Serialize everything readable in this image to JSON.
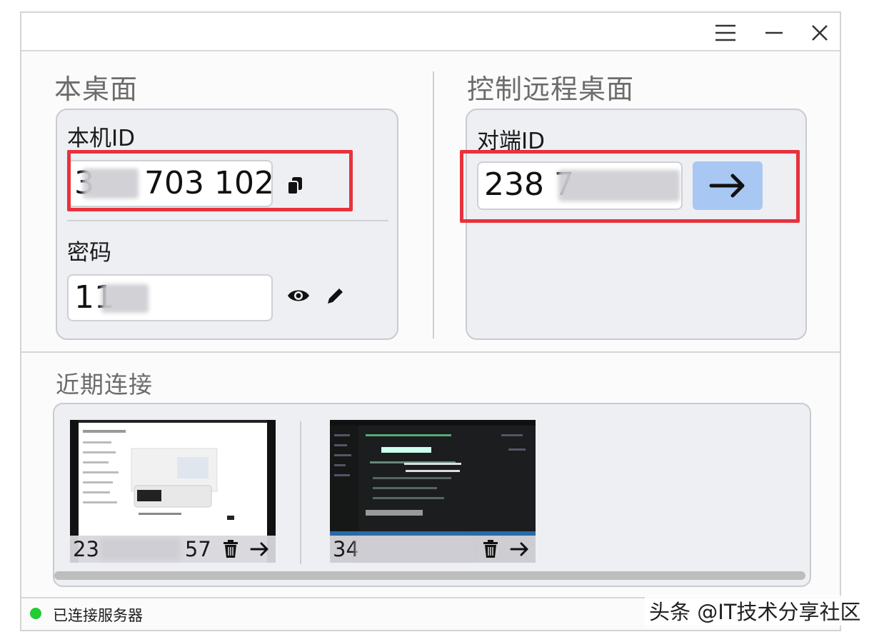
{
  "window": {
    "buttons": {
      "menu": "menu-icon",
      "minimize": "minimize-icon",
      "close": "close-icon"
    }
  },
  "local_desktop": {
    "title": "本桌面",
    "id_label": "本机ID",
    "id_value_prefix": "3",
    "id_value_suffix": "703 102",
    "password_label": "密码",
    "password_value": "11"
  },
  "remote_control": {
    "title": "控制远程桌面",
    "peer_id_label": "对端ID",
    "peer_id_value": "238 7"
  },
  "recent": {
    "title": "近期连接",
    "items": [
      {
        "id_prefix": "23",
        "id_suffix": "57"
      },
      {
        "id_prefix": "34",
        "id_suffix": ""
      }
    ]
  },
  "status": {
    "text": "已连接服务器",
    "color": "#22cc33"
  },
  "watermark": "头条 @IT技术分享社区",
  "colors": {
    "accent": "#a8c8f3",
    "highlight": "#e8323b"
  }
}
